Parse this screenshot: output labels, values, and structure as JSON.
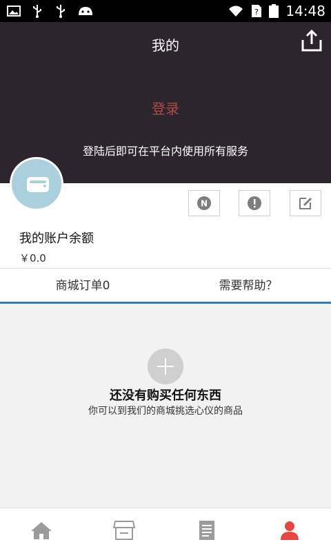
{
  "status_bar": {
    "time": "14:48"
  },
  "header": {
    "title": "我的",
    "login_label": "登录",
    "subtitle": "登陆后即可在平台内使用所有服务"
  },
  "account": {
    "balance_label": "我的账户余额",
    "balance_value": "￥0.0"
  },
  "tabs": [
    {
      "label": "商城订单0"
    },
    {
      "label": "需要帮助？"
    }
  ],
  "empty_state": {
    "title": "还没有购买任何东西",
    "subtitle": "你可以到我们的商城挑选心仪的商品"
  },
  "colors": {
    "header_bg": "#2c252d",
    "login_text": "#b24a45",
    "tab_indicator": "#2a7fae",
    "active_nav": "#e8473f",
    "avatar_bg": "#a9d0dc"
  },
  "icons": {
    "status_left": [
      "image-icon",
      "usb-icon",
      "usb-icon",
      "android-icon"
    ],
    "status_right": [
      "wifi-icon",
      "sim-icon",
      "battery-icon"
    ],
    "card_actions": [
      "notes-n-icon",
      "alert-icon",
      "edit-icon"
    ],
    "bottom_nav": [
      "home-icon",
      "store-icon",
      "document-icon",
      "profile-icon"
    ]
  }
}
